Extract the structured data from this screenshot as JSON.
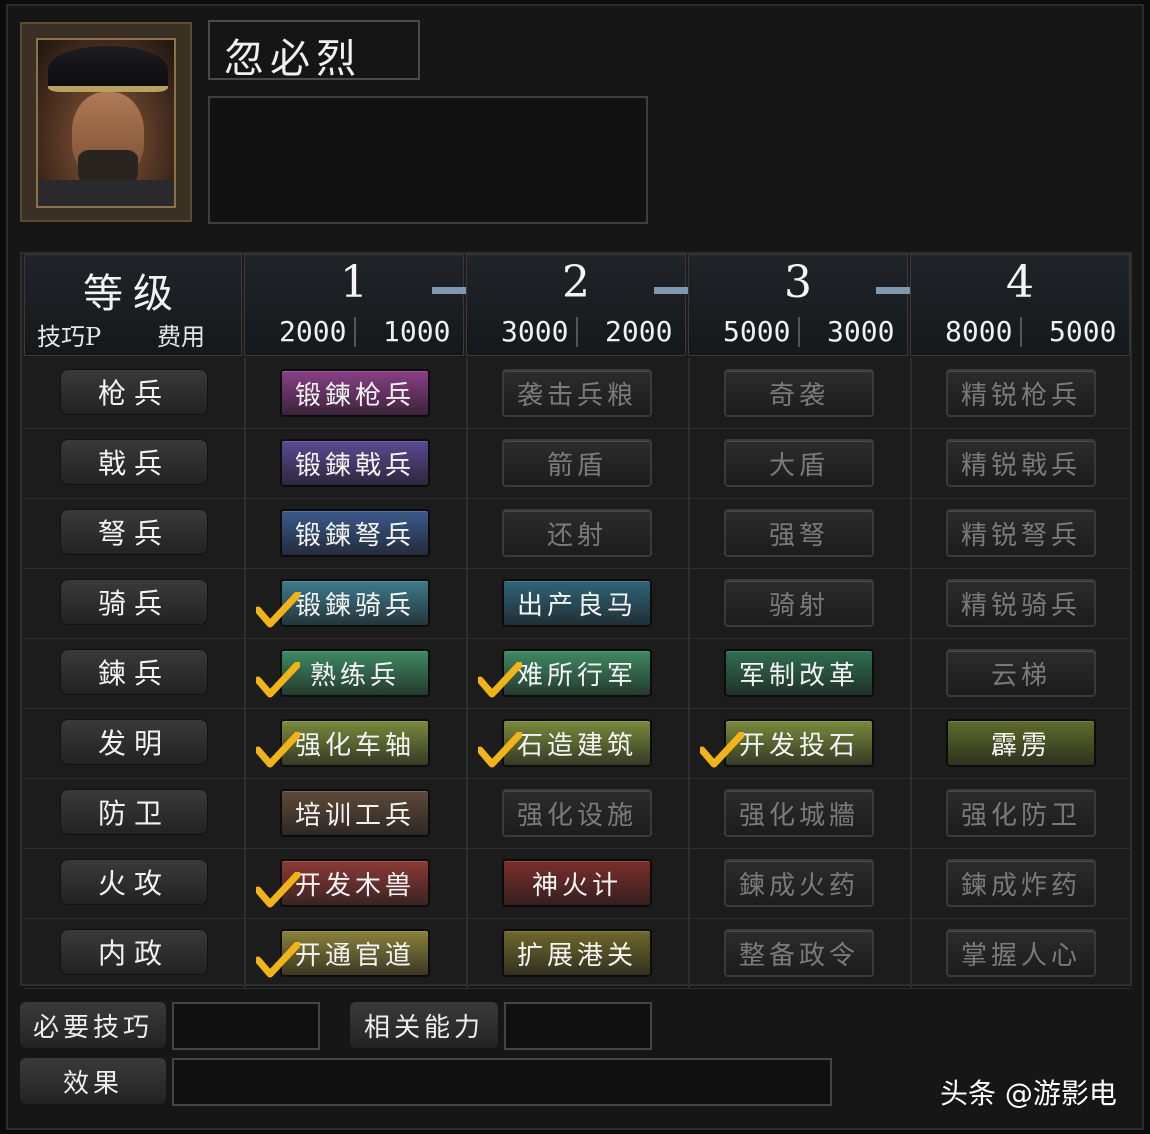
{
  "character": {
    "name": "忽必烈"
  },
  "header": {
    "level_label": "等级",
    "tech_points_label": "技巧P",
    "cost_label": "费用",
    "levels": [
      {
        "number": "1",
        "tech_points": "2000",
        "cost": "1000"
      },
      {
        "number": "2",
        "tech_points": "3000",
        "cost": "2000"
      },
      {
        "number": "3",
        "tech_points": "5000",
        "cost": "3000"
      },
      {
        "number": "4",
        "tech_points": "8000",
        "cost": "5000"
      }
    ]
  },
  "rows": [
    {
      "category": "枪兵",
      "skills": [
        {
          "label": "锻鍊枪兵",
          "color": "#8a3f88",
          "unlocked": true,
          "checked": false
        },
        {
          "label": "袭击兵粮",
          "unlocked": false,
          "checked": false
        },
        {
          "label": "奇袭",
          "unlocked": false,
          "checked": false
        },
        {
          "label": "精锐枪兵",
          "unlocked": false,
          "checked": false
        }
      ]
    },
    {
      "category": "戟兵",
      "skills": [
        {
          "label": "锻鍊戟兵",
          "color": "#5a4a92",
          "unlocked": true,
          "checked": false
        },
        {
          "label": "箭盾",
          "unlocked": false,
          "checked": false
        },
        {
          "label": "大盾",
          "unlocked": false,
          "checked": false
        },
        {
          "label": "精锐戟兵",
          "unlocked": false,
          "checked": false
        }
      ]
    },
    {
      "category": "弩兵",
      "skills": [
        {
          "label": "锻鍊弩兵",
          "color": "#3a5a8c",
          "unlocked": true,
          "checked": false
        },
        {
          "label": "还射",
          "unlocked": false,
          "checked": false
        },
        {
          "label": "强弩",
          "unlocked": false,
          "checked": false
        },
        {
          "label": "精锐弩兵",
          "unlocked": false,
          "checked": false
        }
      ]
    },
    {
      "category": "骑兵",
      "skills": [
        {
          "label": "锻鍊骑兵",
          "color": "#3f7a8c",
          "unlocked": true,
          "checked": true
        },
        {
          "label": "出产良马",
          "color": "#2f6478",
          "unlocked": true,
          "checked": false
        },
        {
          "label": "骑射",
          "unlocked": false,
          "checked": false
        },
        {
          "label": "精锐骑兵",
          "unlocked": false,
          "checked": false
        }
      ]
    },
    {
      "category": "鍊兵",
      "skills": [
        {
          "label": "熟练兵",
          "color": "#3f8a62",
          "unlocked": true,
          "checked": true
        },
        {
          "label": "难所行军",
          "color": "#3f8a62",
          "unlocked": true,
          "checked": true
        },
        {
          "label": "军制改革",
          "color": "#2f6e50",
          "unlocked": true,
          "checked": false
        },
        {
          "label": "云梯",
          "unlocked": false,
          "checked": false
        }
      ]
    },
    {
      "category": "发明",
      "skills": [
        {
          "label": "强化车轴",
          "color": "#7a8a3c",
          "unlocked": true,
          "checked": true
        },
        {
          "label": "石造建筑",
          "color": "#7a8a3c",
          "unlocked": true,
          "checked": true
        },
        {
          "label": "开发投石",
          "color": "#7a8a3c",
          "unlocked": true,
          "checked": true
        },
        {
          "label": "霹雳",
          "color": "#5e6c2a",
          "unlocked": true,
          "checked": false
        }
      ]
    },
    {
      "category": "防卫",
      "skills": [
        {
          "label": "培训工兵",
          "color": "#5e4a3a",
          "unlocked": true,
          "checked": false
        },
        {
          "label": "强化设施",
          "unlocked": false,
          "checked": false
        },
        {
          "label": "强化城牆",
          "unlocked": false,
          "checked": false
        },
        {
          "label": "强化防卫",
          "unlocked": false,
          "checked": false
        }
      ]
    },
    {
      "category": "火攻",
      "skills": [
        {
          "label": "开发木兽",
          "color": "#8c3a36",
          "unlocked": true,
          "checked": true
        },
        {
          "label": "神火计",
          "color": "#7a2e2a",
          "unlocked": true,
          "checked": false
        },
        {
          "label": "鍊成火药",
          "unlocked": false,
          "checked": false
        },
        {
          "label": "鍊成炸药",
          "unlocked": false,
          "checked": false
        }
      ]
    },
    {
      "category": "内政",
      "skills": [
        {
          "label": "开通官道",
          "color": "#8a823a",
          "unlocked": true,
          "checked": true
        },
        {
          "label": "扩展港关",
          "color": "#6e682c",
          "unlocked": true,
          "checked": false
        },
        {
          "label": "整备政令",
          "unlocked": false,
          "checked": false
        },
        {
          "label": "掌握人心",
          "unlocked": false,
          "checked": false
        }
      ]
    }
  ],
  "footer": {
    "required_skill_label": "必要技巧",
    "related_ability_label": "相关能力",
    "effect_label": "效果"
  },
  "watermark": "头条 @游影电"
}
